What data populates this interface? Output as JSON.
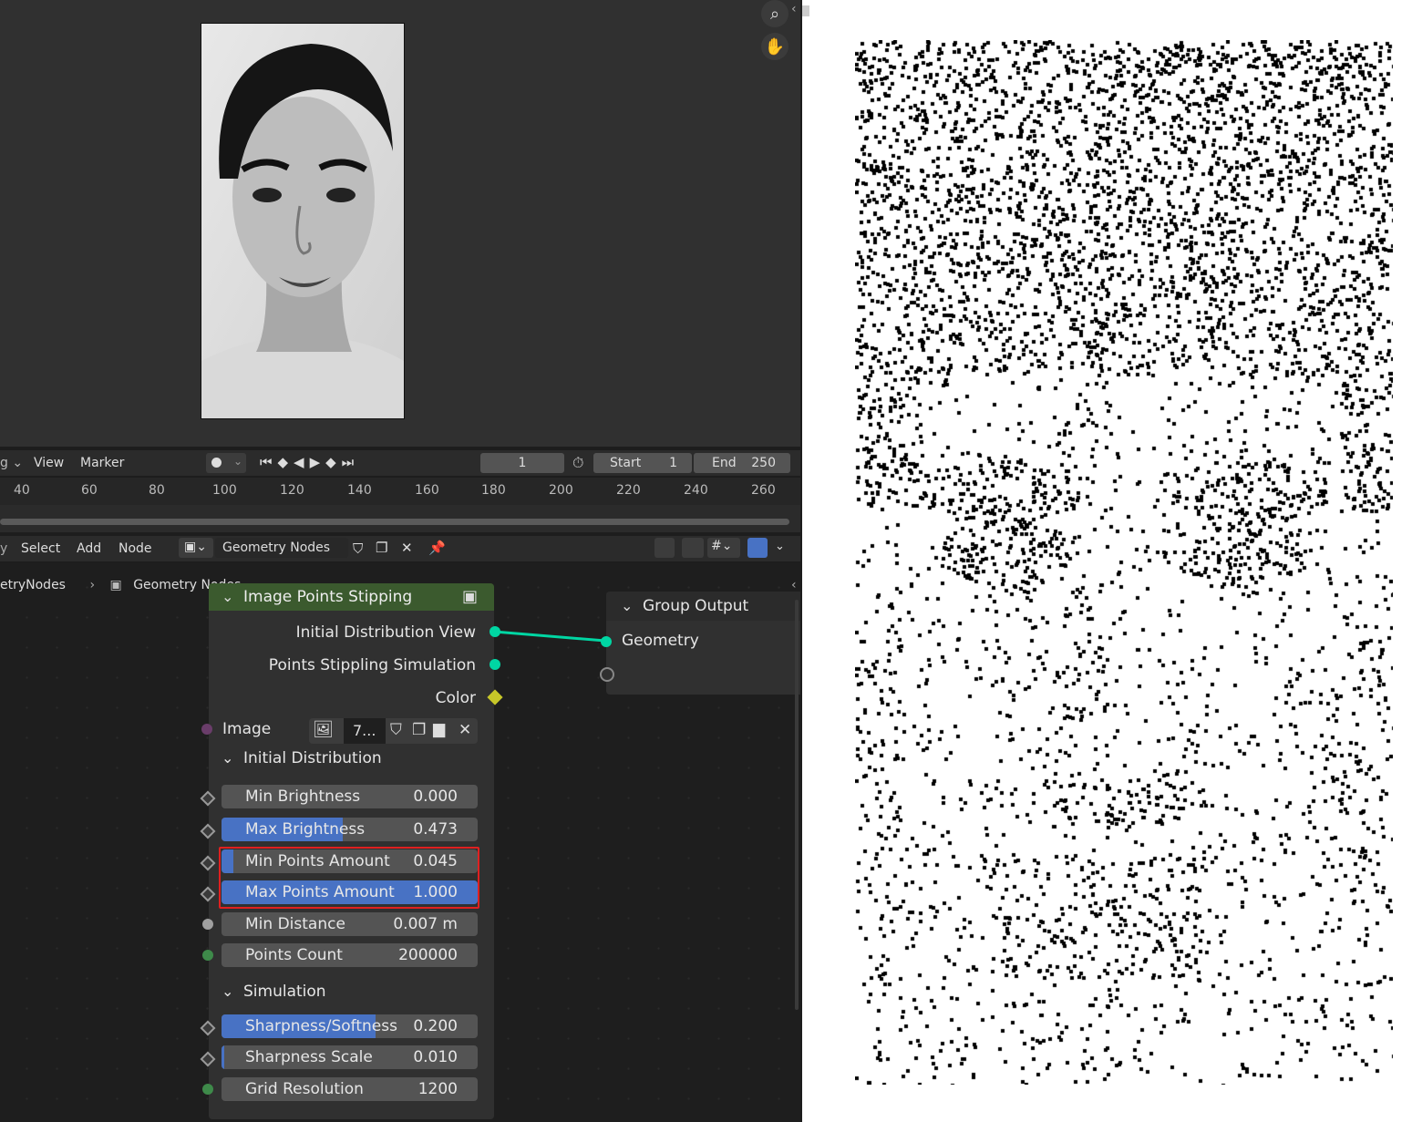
{
  "timeline": {
    "menus": [
      "View",
      "Marker"
    ],
    "current_frame": "1",
    "start_label": "Start",
    "start_value": "1",
    "end_label": "End",
    "end_value": "250",
    "ruler_ticks": [
      "40",
      "60",
      "80",
      "100",
      "120",
      "140",
      "160",
      "180",
      "200",
      "220",
      "240",
      "260"
    ]
  },
  "node_editor": {
    "menus": [
      "Select",
      "Add",
      "Node"
    ],
    "tree_name": "Geometry Nodes",
    "breadcrumb": [
      "etryNodes",
      "Geometry Nodes"
    ]
  },
  "stipple_node": {
    "title": "Image Points Stipping",
    "outputs": [
      "Initial Distribution View",
      "Points Stippling Simulation",
      "Color"
    ],
    "image_label": "Image",
    "image_value": "7...",
    "sections": {
      "initial": "Initial Distribution",
      "simulation": "Simulation"
    },
    "fields": [
      {
        "label": "Min Brightness",
        "value": "0.000",
        "fill": 0.0
      },
      {
        "label": "Max Brightness",
        "value": "0.473",
        "fill": 0.473
      },
      {
        "label": "Min Points Amount",
        "value": "0.045",
        "fill": 0.045
      },
      {
        "label": "Max Points Amount",
        "value": "1.000",
        "fill": 1.0
      },
      {
        "label": "Min Distance",
        "value": "0.007 m",
        "fill": 0.0
      },
      {
        "label": "Points Count",
        "value": "200000",
        "fill": 0.0
      }
    ],
    "sim_fields": [
      {
        "label": "Sharpness/Softness",
        "value": "0.200",
        "fill": 0.6
      },
      {
        "label": "Sharpness Scale",
        "value": "0.010",
        "fill": 0.01
      },
      {
        "label": "Grid Resolution",
        "value": "1200",
        "fill": 0.0
      }
    ]
  },
  "group_output": {
    "title": "Group Output",
    "input": "Geometry"
  },
  "colors": {
    "geometry_socket": "#00d6a3",
    "color_socket": "#c7c729",
    "highlight": "#e02020",
    "node_header": "#3b5a2e"
  }
}
